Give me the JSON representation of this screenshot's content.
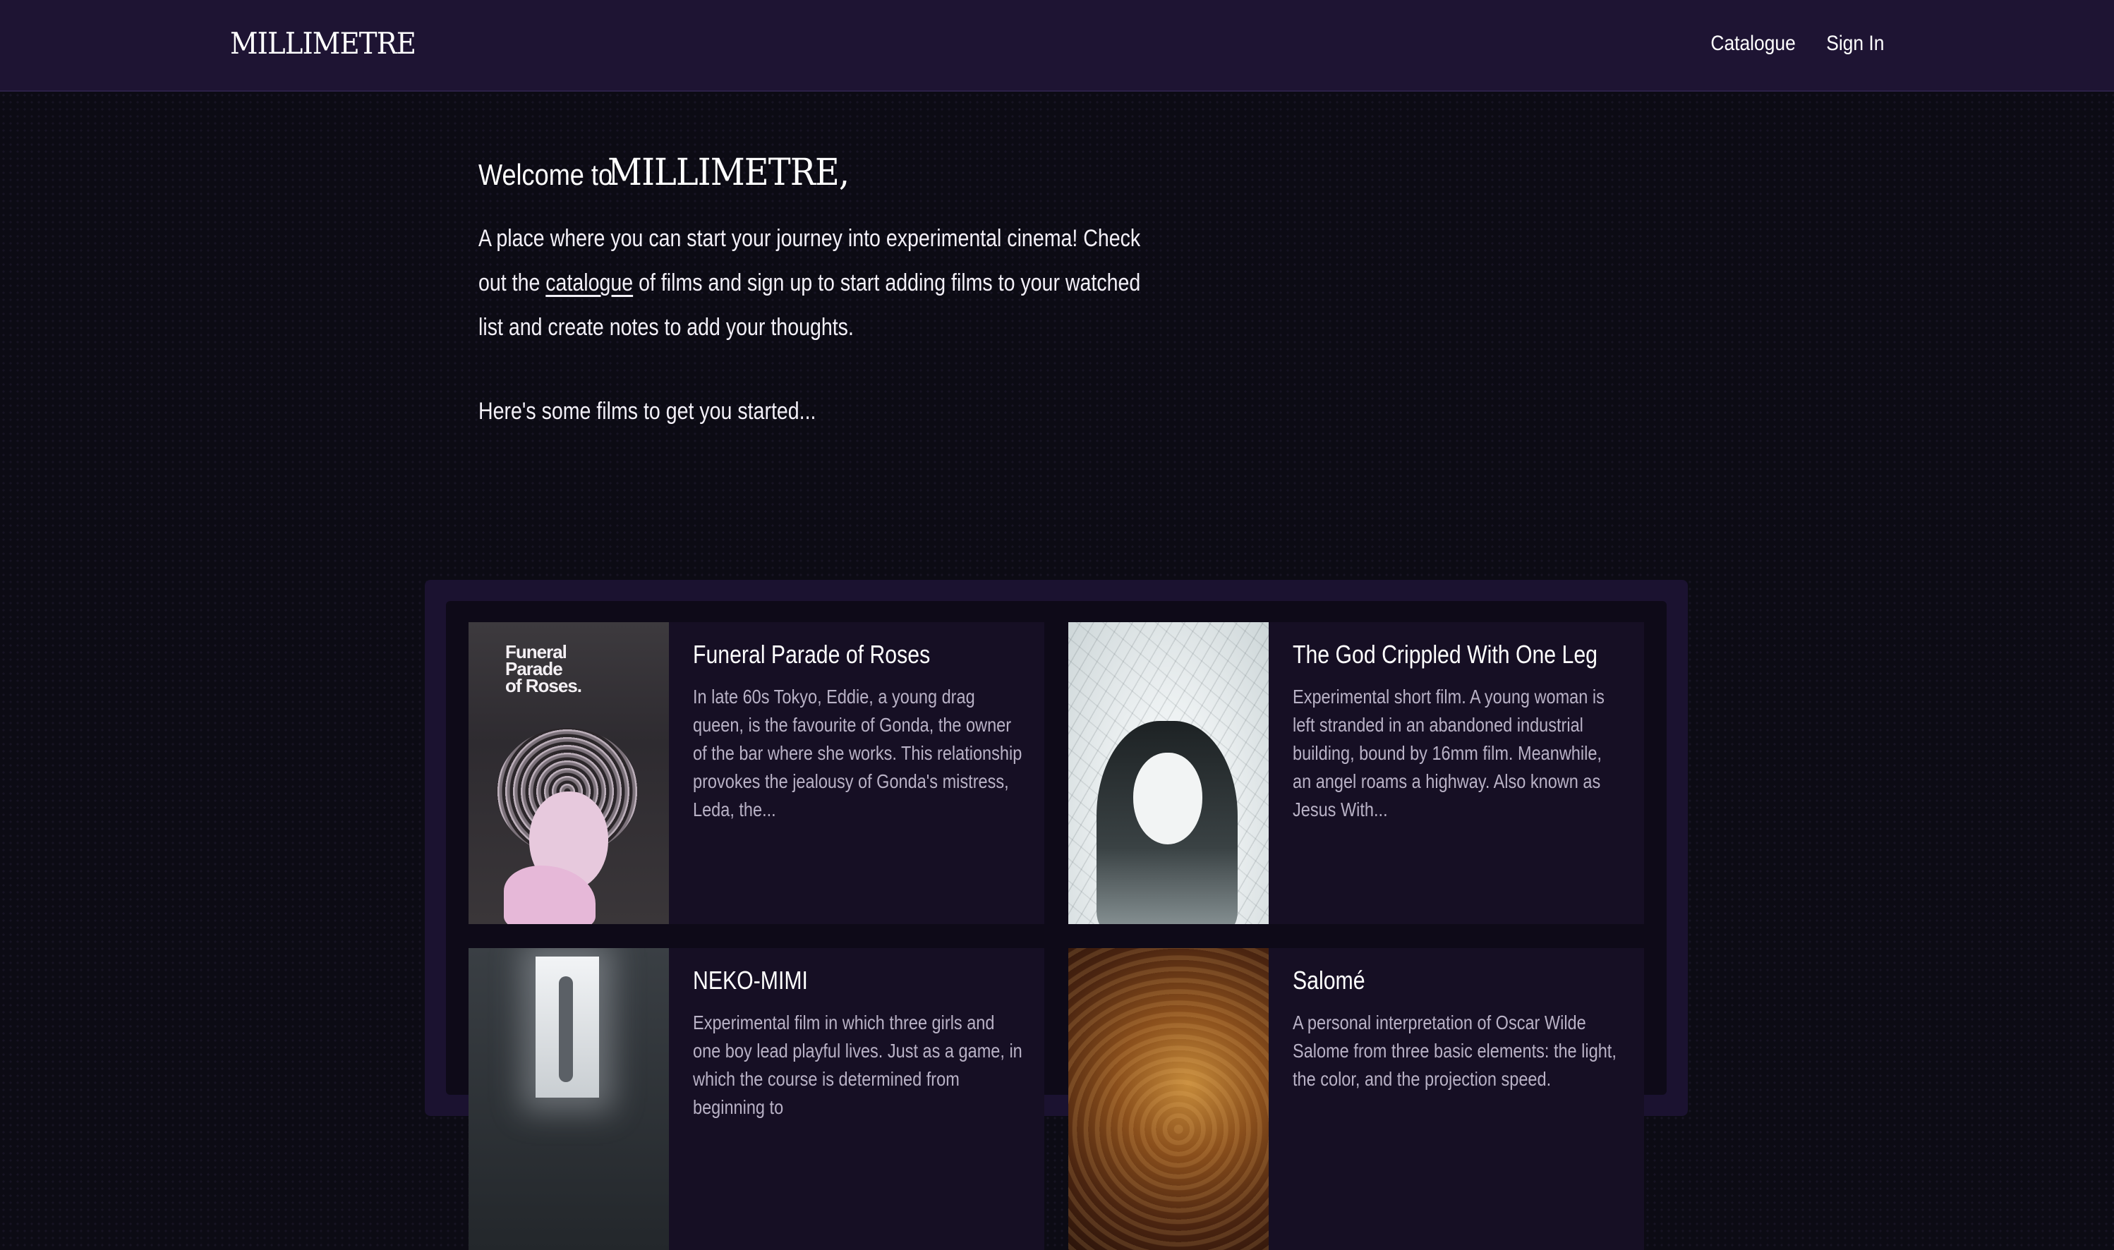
{
  "navbar": {
    "brand": "MILLIMETRE",
    "links": [
      "Catalogue",
      "Sign In"
    ]
  },
  "intro": {
    "welcome_prefix": "Welcome to",
    "welcome_brand": "MILLIMETRE,",
    "paragraph_start": "A place where you can start your journey into experimental cinema! Check out the ",
    "catalogue_link": "catalogue",
    "paragraph_end": " of films and sign up to start adding films to your watched list and create notes to add your thoughts.",
    "started": "Here's some films to get you started..."
  },
  "films": [
    {
      "title": "Funeral Parade of Roses",
      "description": "In late 60s Tokyo, Eddie, a young drag queen, is the favourite of Gonda, the owner of the bar where she works. This relationship provokes the jealousy of Gonda's mistress, Leda, the...",
      "poster_text": "Funeral Parade of Roses."
    },
    {
      "title": "The God Crippled With One Leg",
      "description": "Experimental short film. A young woman is left stranded in an abandoned industrial building, bound by 16mm film. Meanwhile, an angel roams a highway. Also known as Jesus With..."
    },
    {
      "title": "NEKO-MIMI",
      "description": "Experimental film in which three girls and one boy lead playful lives. Just as a game, in which the course is determined from beginning to"
    },
    {
      "title": "Salomé",
      "description": "A personal interpretation of Oscar Wilde Salome from three basic elements: the light, the color, and the projection speed."
    }
  ],
  "colors": {
    "background": "#0c0b14",
    "navbar": "#1e1433",
    "panel_outer": "#1b1230",
    "panel_inner": "#0e0a18",
    "card": "#160f24",
    "description_text": "#b9b2c6"
  }
}
